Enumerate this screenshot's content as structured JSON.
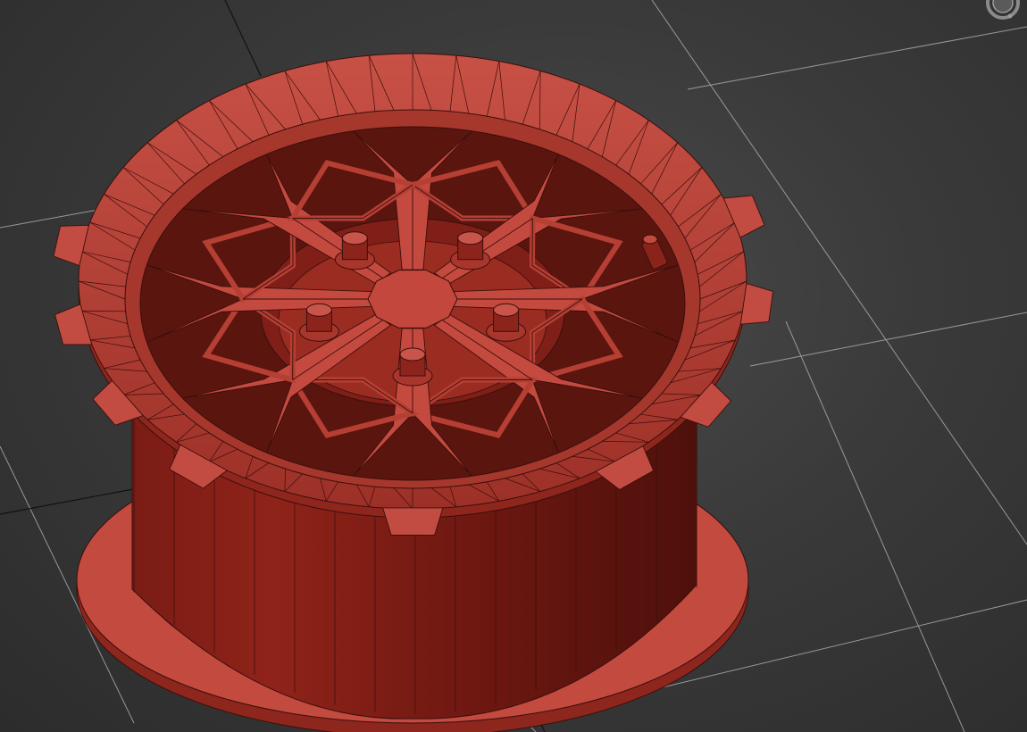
{
  "viewport": {
    "background_color": "#3c3c3c",
    "grid_color": "#b8b8b8",
    "object_color": "#c0443a",
    "object_edge_color": "#3a0f0c",
    "object_shadow_color": "#5a1410",
    "view_mode": "perspective",
    "shading": "smooth-with-edged-faces"
  },
  "scene_object": {
    "kind": "wheel-rim",
    "spoke_count": 8,
    "lug_nut_count": 5,
    "valve_stem": true
  },
  "viewcube": {
    "icon": "viewcube-icon"
  }
}
